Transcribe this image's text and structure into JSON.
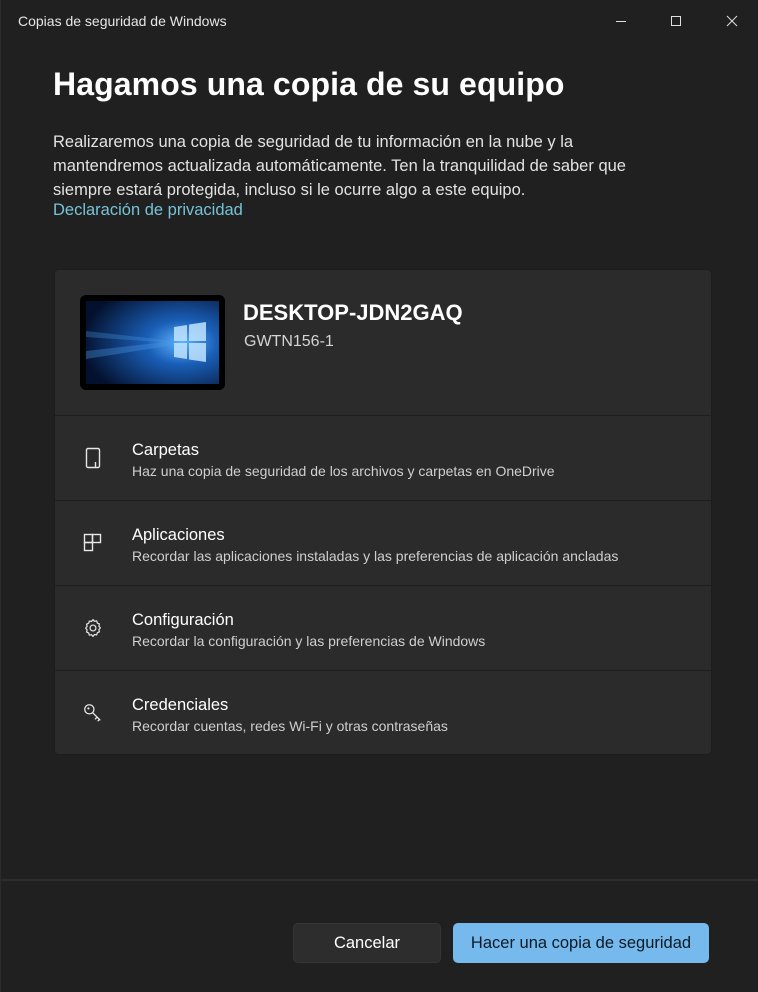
{
  "window": {
    "title": "Copias de seguridad de Windows",
    "minimize_icon": "minimize-icon",
    "maximize_icon": "maximize-icon",
    "close_icon": "close-icon"
  },
  "header": {
    "heading": "Hagamos una copia de su equipo",
    "intro": "Realizaremos una copia de seguridad de tu información en la nube y la mantendremos actualizada automáticamente. Ten la tranquilidad de saber que siempre estará protegida, incluso si le ocurre algo a este equipo.",
    "privacy_link": "Declaración de privacidad"
  },
  "device": {
    "name": "DESKTOP-JDN2GAQ",
    "model": "GWTN156-1"
  },
  "items": [
    {
      "title": "Carpetas",
      "description": "Haz una copia de seguridad de los archivos y carpetas en OneDrive",
      "icon": "folder-icon"
    },
    {
      "title": "Aplicaciones",
      "description": "Recordar las aplicaciones instaladas y las preferencias de aplicación ancladas",
      "icon": "apps-icon"
    },
    {
      "title": "Configuración",
      "description": "Recordar la configuración y las preferencias de Windows",
      "icon": "gear-icon"
    },
    {
      "title": "Credenciales",
      "description": "Recordar cuentas, redes Wi-Fi y otras contraseñas",
      "icon": "key-icon"
    }
  ],
  "footer": {
    "cancel_label": "Cancelar",
    "backup_label": "Hacer una copia de seguridad"
  },
  "colors": {
    "background": "#202020",
    "card": "#2b2b2b",
    "accent": "#76b9ed",
    "link": "#76c3d7"
  }
}
